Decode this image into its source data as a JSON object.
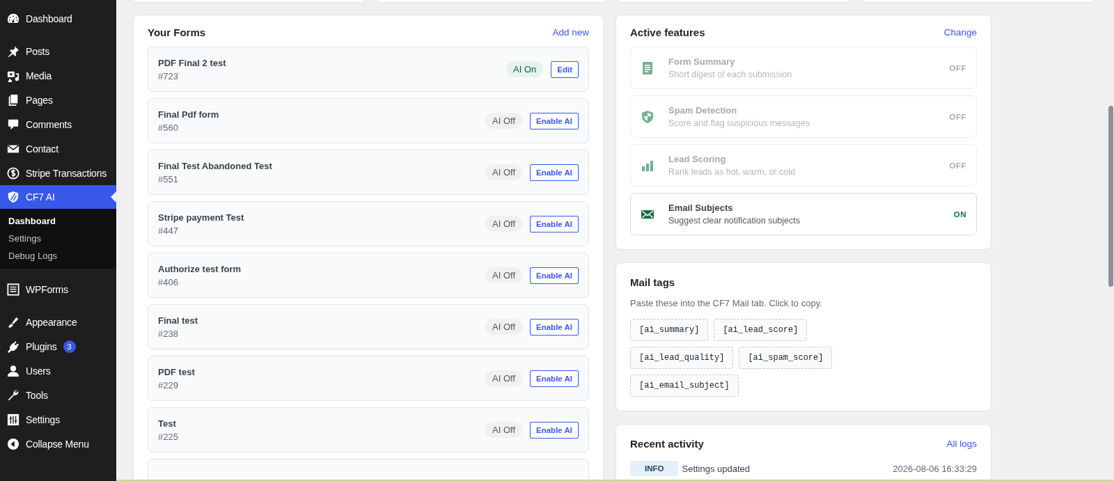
{
  "sidebar": {
    "items": [
      {
        "label": "Dashboard",
        "selected": false
      },
      {
        "label": "Posts",
        "selected": false
      },
      {
        "label": "Media",
        "selected": false
      },
      {
        "label": "Pages",
        "selected": false
      },
      {
        "label": "Comments",
        "selected": false
      },
      {
        "label": "Contact",
        "selected": false
      },
      {
        "label": "Stripe Transactions",
        "selected": false
      },
      {
        "label": "CF7 AI",
        "selected": true,
        "children": [
          {
            "label": "Dashboard",
            "selected": true
          },
          {
            "label": "Settings",
            "selected": false
          },
          {
            "label": "Debug Logs",
            "selected": false
          }
        ]
      },
      {
        "label": "WPForms",
        "selected": false
      },
      {
        "label": "Appearance",
        "selected": false
      },
      {
        "label": "Plugins",
        "selected": false,
        "badge": "3"
      },
      {
        "label": "Users",
        "selected": false
      },
      {
        "label": "Tools",
        "selected": false
      },
      {
        "label": "Settings",
        "selected": false
      },
      {
        "label": "Collapse Menu",
        "selected": false
      }
    ]
  },
  "forms": {
    "title": "Your Forms",
    "link": "Add new",
    "rows": [
      {
        "name": "PDF Final 2 test",
        "number": "#723",
        "status": "AI On",
        "ai_on": true,
        "action": "Edit"
      },
      {
        "name": "Final Pdf form",
        "number": "#560",
        "status": "AI Off",
        "ai_on": false,
        "action": "Enable AI"
      },
      {
        "name": "Final Test Abandoned Test",
        "number": "#551",
        "status": "AI Off",
        "ai_on": false,
        "action": "Enable AI"
      },
      {
        "name": "Stripe payment Test",
        "number": "#447",
        "status": "AI Off",
        "ai_on": false,
        "action": "Enable AI"
      },
      {
        "name": "Authorize test form",
        "number": "#406",
        "status": "AI Off",
        "ai_on": false,
        "action": "Enable AI"
      },
      {
        "name": "Final test",
        "number": "#238",
        "status": "AI Off",
        "ai_on": false,
        "action": "Enable AI"
      },
      {
        "name": "PDF test",
        "number": "#229",
        "status": "AI Off",
        "ai_on": false,
        "action": "Enable AI"
      },
      {
        "name": "Test",
        "number": "#225",
        "status": "AI Off",
        "ai_on": false,
        "action": "Enable AI"
      }
    ]
  },
  "active_features": {
    "title": "Active features",
    "link": "Change",
    "items": [
      {
        "title": "Form Summary",
        "description": "Short digest of each submission",
        "state": "OFF",
        "on": false
      },
      {
        "title": "Spam Detection",
        "description": "Score and flag suspicious messages",
        "state": "OFF",
        "on": false
      },
      {
        "title": "Lead Scoring",
        "description": "Rank leads as hot, warm, or cold",
        "state": "OFF",
        "on": false
      },
      {
        "title": "Email Subjects",
        "description": "Suggest clear notification subjects",
        "state": "ON",
        "on": true
      }
    ]
  },
  "mail_tags": {
    "title": "Mail tags",
    "description": "Paste these into the CF7 Mail tab. Click to copy.",
    "tags": [
      "[ai_summary]",
      "[ai_lead_score]",
      "[ai_lead_quality]",
      "[ai_spam_score]",
      "[ai_email_subject]"
    ]
  },
  "recent_activity": {
    "title": "Recent activity",
    "link": "All logs",
    "entries": [
      {
        "level": "INFO",
        "message": "Settings updated",
        "time": "2026-08-06 16:33:29"
      }
    ]
  }
}
